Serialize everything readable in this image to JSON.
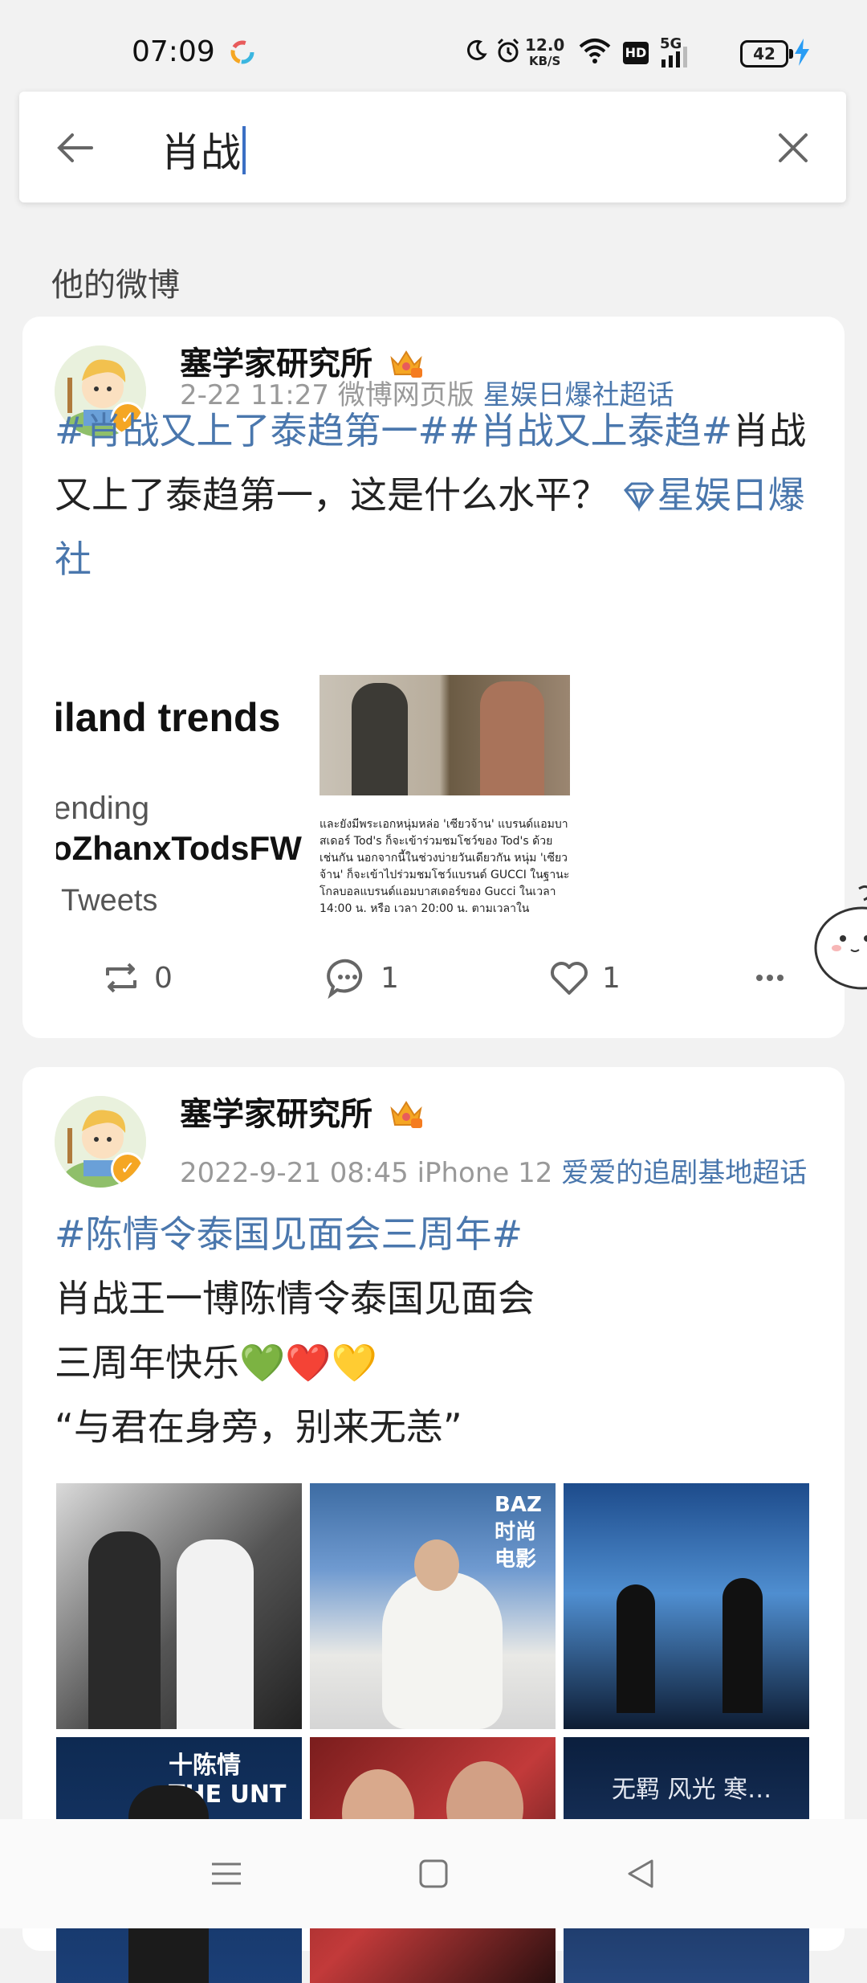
{
  "status_bar": {
    "time": "07:09",
    "net_speed_value": "12.0",
    "net_speed_unit": "KB/S",
    "hd_label": "HD",
    "signal_label": "5G",
    "battery": "42"
  },
  "search": {
    "query": "肖战"
  },
  "section": {
    "title": "他的微博"
  },
  "posts": [
    {
      "author": "塞学家研究所",
      "time": "2-22 11:27",
      "source": "微博网页版",
      "topic": "星娱日爆社超话",
      "tag1": "#肖战又上了泰趋第一#",
      "tag2": "#肖战又上泰趋#",
      "text_after_tags": "肖战又上了泰趋第一，这是什么水平？",
      "link_text": "星娱日爆社",
      "image1": {
        "line1": "iland trends",
        "line2": "ending",
        "line3": "oZhanxTodsFW",
        "line4": "Tweets"
      },
      "image2": {
        "caption": "และยังมีพระเอกหนุ่มหล่อ 'เซียวจ้าน' แบรนด์แอมบาสเดอร์ Tod's ก็จะเข้าร่วมชมโชว์ของ Tod's ด้วยเช่นกัน นอกจากนี้ในช่วงบ่ายวันเดียวกัน หนุ่ม 'เซียวจ้าน' ก็จะเข้าไปร่วมชมโชว์แบรนด์ GUCCI ในฐานะโกลบอลแบรนด์แอมบาสเดอร์ของ Gucci ในเวลา 14:00 น. หรือ เวลา 20:00 น. ตามเวลาใน"
      },
      "reposts": "0",
      "comments": "1",
      "likes": "1"
    },
    {
      "author": "塞学家研究所",
      "time": "2022-9-21 08:45",
      "source": "iPhone 12",
      "topic": "爱爱的追剧基地超话",
      "tag1": "#陈情令泰国见面会三周年#",
      "line1": "肖战王一博陈情令泰国见面会",
      "line2": "三周年快乐💚❤️💛",
      "line3": "“与君在身旁，别来无恙”",
      "image_b_text": "BAZ 时尚 电影",
      "image_d_text": "十陈情 THE UNT",
      "image_f_text": "无羁 风光 寒…"
    }
  ],
  "colors": {
    "link": "#4a77ad",
    "background": "#f2f2f2",
    "card": "#ffffff",
    "meta": "#999999",
    "caret": "#3b6fc4"
  }
}
